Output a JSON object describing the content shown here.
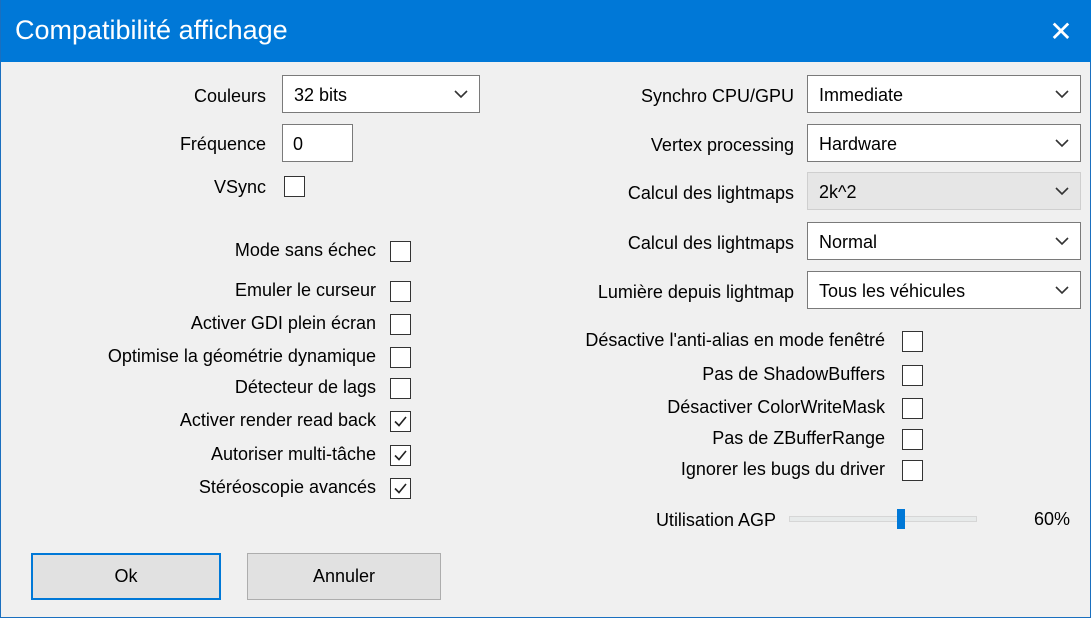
{
  "window": {
    "title": "Compatibilité affichage",
    "close_glyph": "✕"
  },
  "left": {
    "couleurs": {
      "label": "Couleurs",
      "value": "32 bits"
    },
    "frequence": {
      "label": "Fréquence",
      "value": "0"
    },
    "vsync": {
      "label": "VSync",
      "checked": false
    },
    "options": [
      {
        "label": "Mode sans échec",
        "checked": false
      },
      {
        "label": "Emuler le curseur",
        "checked": false
      },
      {
        "label": "Activer GDI plein écran",
        "checked": false
      },
      {
        "label": "Optimise la géométrie dynamique",
        "checked": false
      },
      {
        "label": "Détecteur de lags",
        "checked": false
      },
      {
        "label": "Activer render read back",
        "checked": true
      },
      {
        "label": "Autoriser multi-tâche",
        "checked": true
      },
      {
        "label": "Stéréoscopie avancés",
        "checked": true
      }
    ]
  },
  "right": {
    "selects": [
      {
        "label": "Synchro CPU/GPU",
        "value": "Immediate",
        "disabled": false
      },
      {
        "label": "Vertex processing",
        "value": "Hardware",
        "disabled": false
      },
      {
        "label": "Calcul des lightmaps",
        "value": "2k^2",
        "disabled": true
      },
      {
        "label": "Calcul des lightmaps",
        "value": "Normal",
        "disabled": false
      },
      {
        "label": "Lumière depuis lightmap",
        "value": "Tous les véhicules",
        "disabled": false
      }
    ],
    "options": [
      {
        "label": "Désactive l'anti-alias en mode fenêtré",
        "checked": false
      },
      {
        "label": "Pas de ShadowBuffers",
        "checked": false
      },
      {
        "label": "Désactiver ColorWriteMask",
        "checked": false
      },
      {
        "label": "Pas de ZBufferRange",
        "checked": false
      },
      {
        "label": "Ignorer les bugs du driver",
        "checked": false
      }
    ],
    "agp": {
      "label": "Utilisation AGP",
      "value_text": "60%",
      "fraction": 0.6
    }
  },
  "buttons": {
    "ok": "Ok",
    "cancel": "Annuler"
  },
  "colors": {
    "accent": "#0078d7",
    "dialog_bg": "#f0f0f0"
  }
}
